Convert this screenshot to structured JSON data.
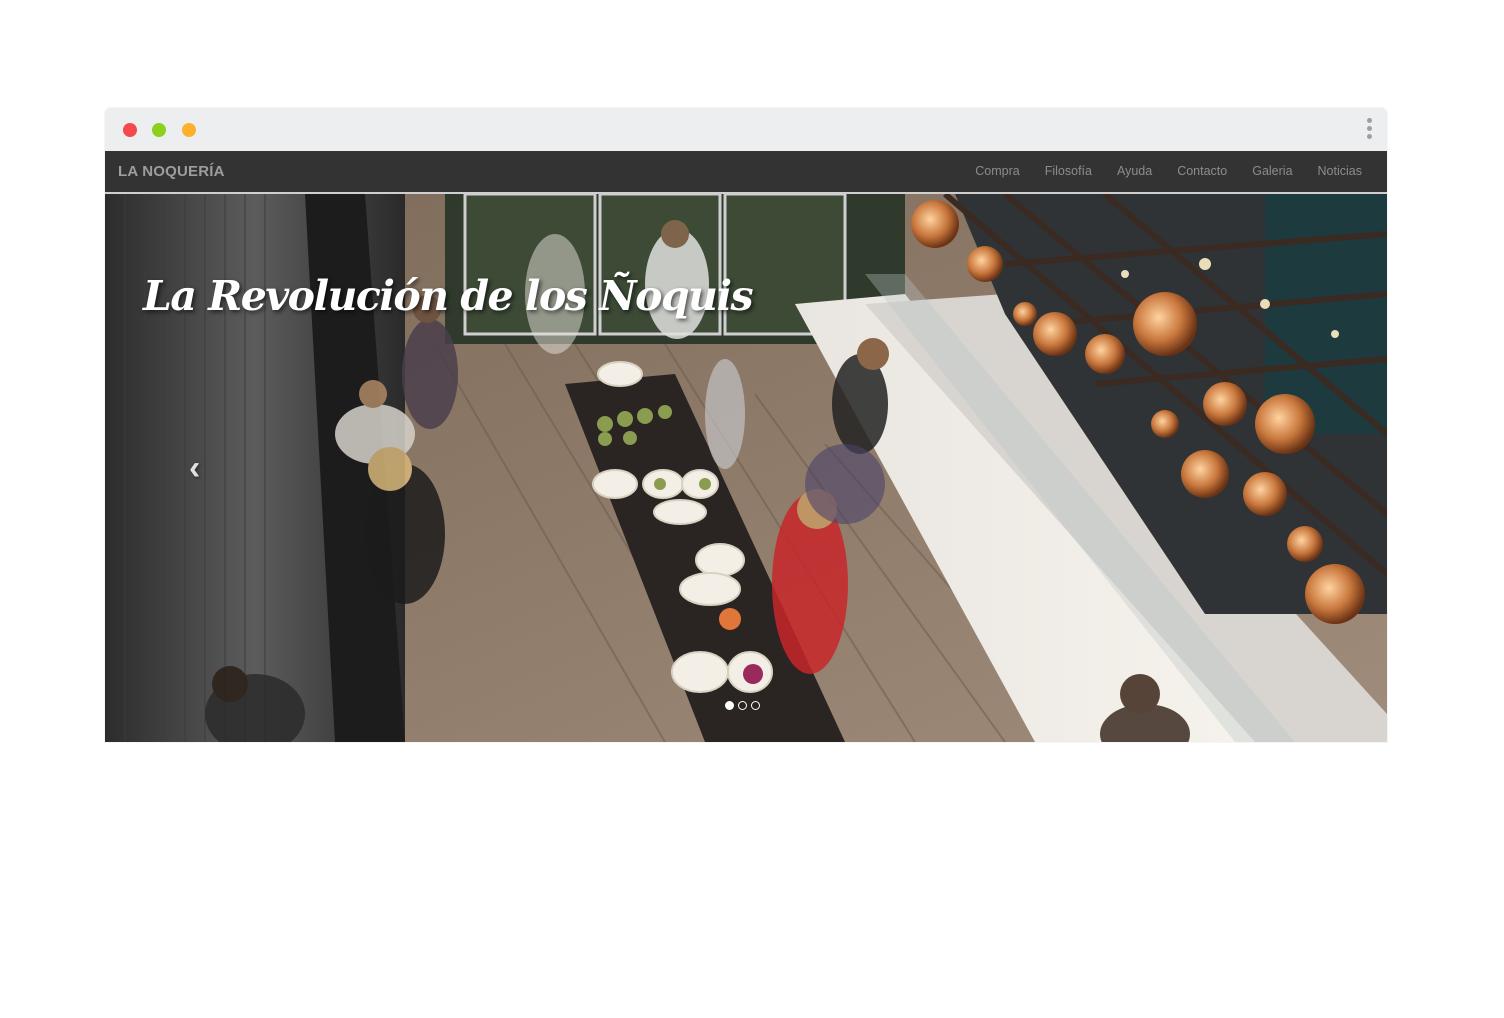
{
  "window": {
    "controls": [
      "close",
      "minimize",
      "maximize"
    ]
  },
  "navbar": {
    "brand": "LA NOQUERÍA",
    "items": [
      {
        "label": "Compra"
      },
      {
        "label": "Filosofía"
      },
      {
        "label": "Ayuda"
      },
      {
        "label": "Contacto"
      },
      {
        "label": "Galeria"
      },
      {
        "label": "Noticias"
      }
    ]
  },
  "carousel": {
    "title": "La Revolución de los Ñoquis",
    "prev_icon": "chevron-left-icon",
    "slide_count": 3,
    "active_slide": 1
  },
  "colors": {
    "close": "#f44a4a",
    "minimize": "#8ccf1d",
    "maximize": "#fbb22a",
    "navbar_bg": "#333333"
  }
}
